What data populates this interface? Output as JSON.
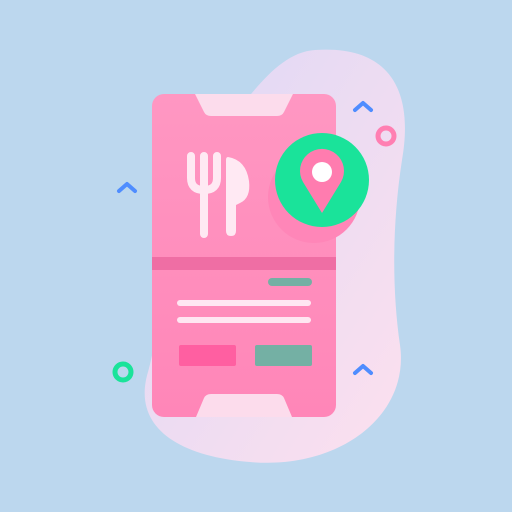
{
  "colors": {
    "background": "#bcd7ee",
    "blob_start": "#ddd8f6",
    "blob_end": "#fde0ee",
    "phone_top": "#ff97c2",
    "phone_bottom": "#ff86b8",
    "phone_panel": "#fcdcec",
    "divider": "#ef6ea4",
    "cutlery": "#ffe9f3",
    "text_lines": "#ffe6f2",
    "accent_green": "#1ae39a",
    "pin": "#ff7caf",
    "pin_dot": "#ffffff",
    "button_pink": "#ff5fa1",
    "button_teal": "#74b0a4",
    "arrow_blue": "#4f8dff",
    "ring_pink": "#ff7fb2",
    "ring_green": "#1ae39a"
  },
  "icons": {
    "phone": "smartphone-icon",
    "fork": "fork-icon",
    "knife": "knife-icon",
    "location": "location-pin-icon",
    "up_arrow": "chevron-up-icon",
    "ring": "circle-outline-icon"
  }
}
